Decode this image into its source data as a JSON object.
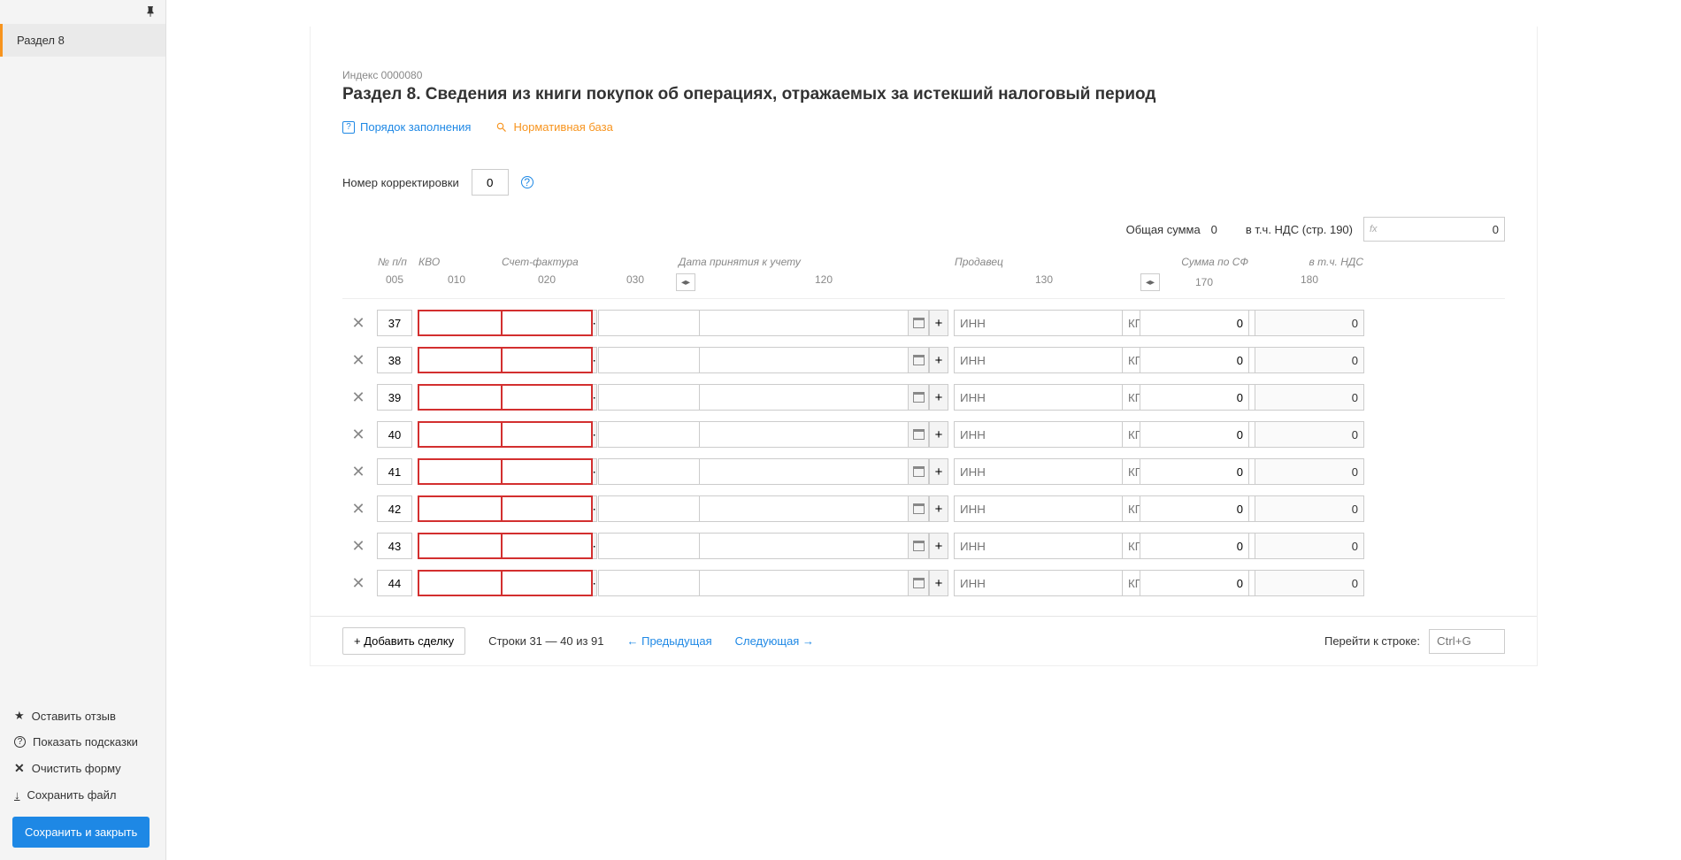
{
  "sidebar": {
    "section_item": "Раздел 8",
    "leave_review": "Оставить отзыв",
    "show_hints": "Показать подсказки",
    "clear_form": "Очистить форму",
    "save_file": "Сохранить файл",
    "save_close": "Сохранить и закрыть"
  },
  "header": {
    "index": "Индекс 0000080",
    "title": "Раздел 8. Сведения из книги покупок об операциях, отражаемых за истекший налоговый период",
    "fill_order": "Порядок заполнения",
    "norm_base": "Нормативная база"
  },
  "correction": {
    "label": "Номер корректировки",
    "value": "0"
  },
  "totals": {
    "total_label": "Общая сумма",
    "total_value": "0",
    "nds_label": "в т.ч. НДС (стр. 190)",
    "nds_value": "0",
    "fx": "fx"
  },
  "columns": {
    "npn": "№ п/п",
    "kvo": "КВО",
    "invoice": "Счет-фактура",
    "accept_date": "Дата принятия к учету",
    "seller": "Продавец",
    "sum_sf": "Сумма по СФ",
    "incl_nds": "в т.ч. НДС",
    "c005": "005",
    "c010": "010",
    "c020": "020",
    "c030": "030",
    "c120": "120",
    "c130": "130",
    "c170": "170",
    "c180": "180"
  },
  "placeholders": {
    "inn": "ИНН",
    "kpp": "КПП",
    "goto": "Ctrl+G"
  },
  "rows": [
    {
      "n": "37",
      "sum": "0",
      "nds": "0"
    },
    {
      "n": "38",
      "sum": "0",
      "nds": "0"
    },
    {
      "n": "39",
      "sum": "0",
      "nds": "0"
    },
    {
      "n": "40",
      "sum": "0",
      "nds": "0"
    },
    {
      "n": "41",
      "sum": "0",
      "nds": "0"
    },
    {
      "n": "42",
      "sum": "0",
      "nds": "0"
    },
    {
      "n": "43",
      "sum": "0",
      "nds": "0"
    },
    {
      "n": "44",
      "sum": "0",
      "nds": "0"
    }
  ],
  "footer": {
    "add": "+ Добавить сделку",
    "range": "Строки 31 — 40 из 91",
    "prev": "← Предыдущая",
    "next": "Следующая →",
    "goto_label": "Перейти к строке:"
  }
}
